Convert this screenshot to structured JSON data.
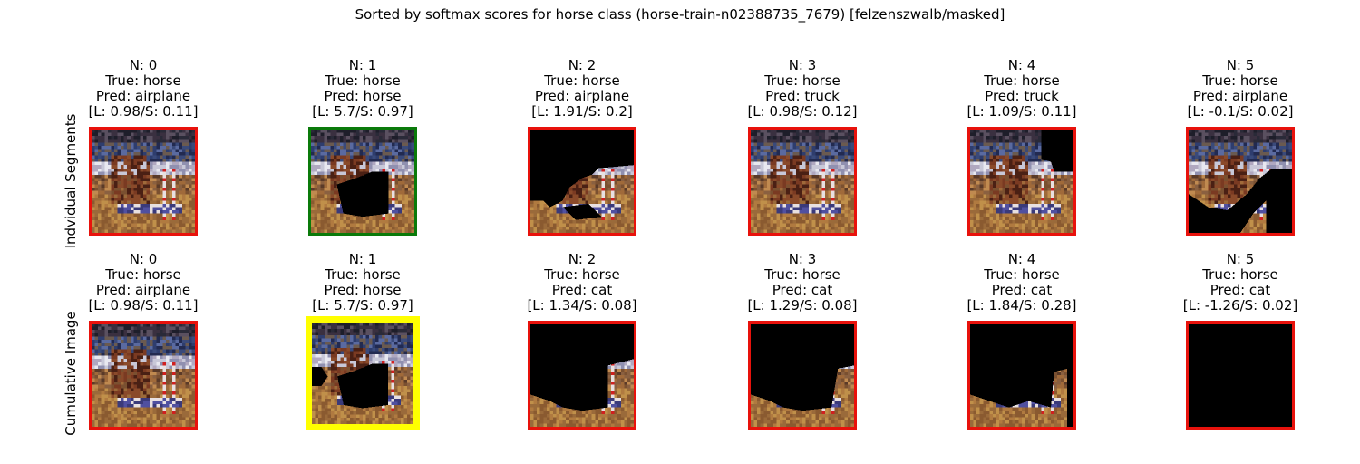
{
  "title": "Sorted by softmax scores for horse class (horse-train-n02388735_7679) [felzenszwalb/masked]",
  "row_labels": [
    "Indvidual Segments",
    "Cumulative Image"
  ],
  "border_colors": {
    "wrong": "#e8120c",
    "correct": "#0a7a0a",
    "best": "#ffff00"
  },
  "rows": [
    {
      "panels": [
        {
          "n": "N: 0",
          "true": "True: horse",
          "pred": "Pred: airplane",
          "score": "[L: 0.98/S: 0.11]",
          "border": "wrong",
          "mask": "none"
        },
        {
          "n": "N: 1",
          "true": "True: horse",
          "pred": "Pred: horse",
          "score": "[L: 5.7/S: 0.97]",
          "border": "correct",
          "mask": "seg1"
        },
        {
          "n": "N: 2",
          "true": "True: horse",
          "pred": "Pred: airplane",
          "score": "[L: 1.91/S: 0.2]",
          "border": "wrong",
          "mask": "seg2"
        },
        {
          "n": "N: 3",
          "true": "True: horse",
          "pred": "Pred: truck",
          "score": "[L: 0.98/S: 0.12]",
          "border": "wrong",
          "mask": "none"
        },
        {
          "n": "N: 4",
          "true": "True: horse",
          "pred": "Pred: truck",
          "score": "[L: 1.09/S: 0.11]",
          "border": "wrong",
          "mask": "seg4"
        },
        {
          "n": "N: 5",
          "true": "True: horse",
          "pred": "Pred: airplane",
          "score": "[L: -0.1/S: 0.02]",
          "border": "wrong",
          "mask": "seg5"
        }
      ]
    },
    {
      "panels": [
        {
          "n": "N: 0",
          "true": "True: horse",
          "pred": "Pred: airplane",
          "score": "[L: 0.98/S: 0.11]",
          "border": "wrong",
          "mask": "none"
        },
        {
          "n": "N: 1",
          "true": "True: horse",
          "pred": "Pred: horse",
          "score": "[L: 5.7/S: 0.97]",
          "border": "best",
          "mask": "cum1"
        },
        {
          "n": "N: 2",
          "true": "True: horse",
          "pred": "Pred: cat",
          "score": "[L: 1.34/S: 0.08]",
          "border": "wrong",
          "mask": "cum2"
        },
        {
          "n": "N: 3",
          "true": "True: horse",
          "pred": "Pred: cat",
          "score": "[L: 1.29/S: 0.08]",
          "border": "wrong",
          "mask": "cum3"
        },
        {
          "n": "N: 4",
          "true": "True: horse",
          "pred": "Pred: cat",
          "score": "[L: 1.84/S: 0.28]",
          "border": "wrong",
          "mask": "cum4"
        },
        {
          "n": "N: 5",
          "true": "True: horse",
          "pred": "Pred: cat",
          "score": "[L: -1.26/S: 0.02]",
          "border": "wrong",
          "mask": "all"
        }
      ]
    }
  ]
}
